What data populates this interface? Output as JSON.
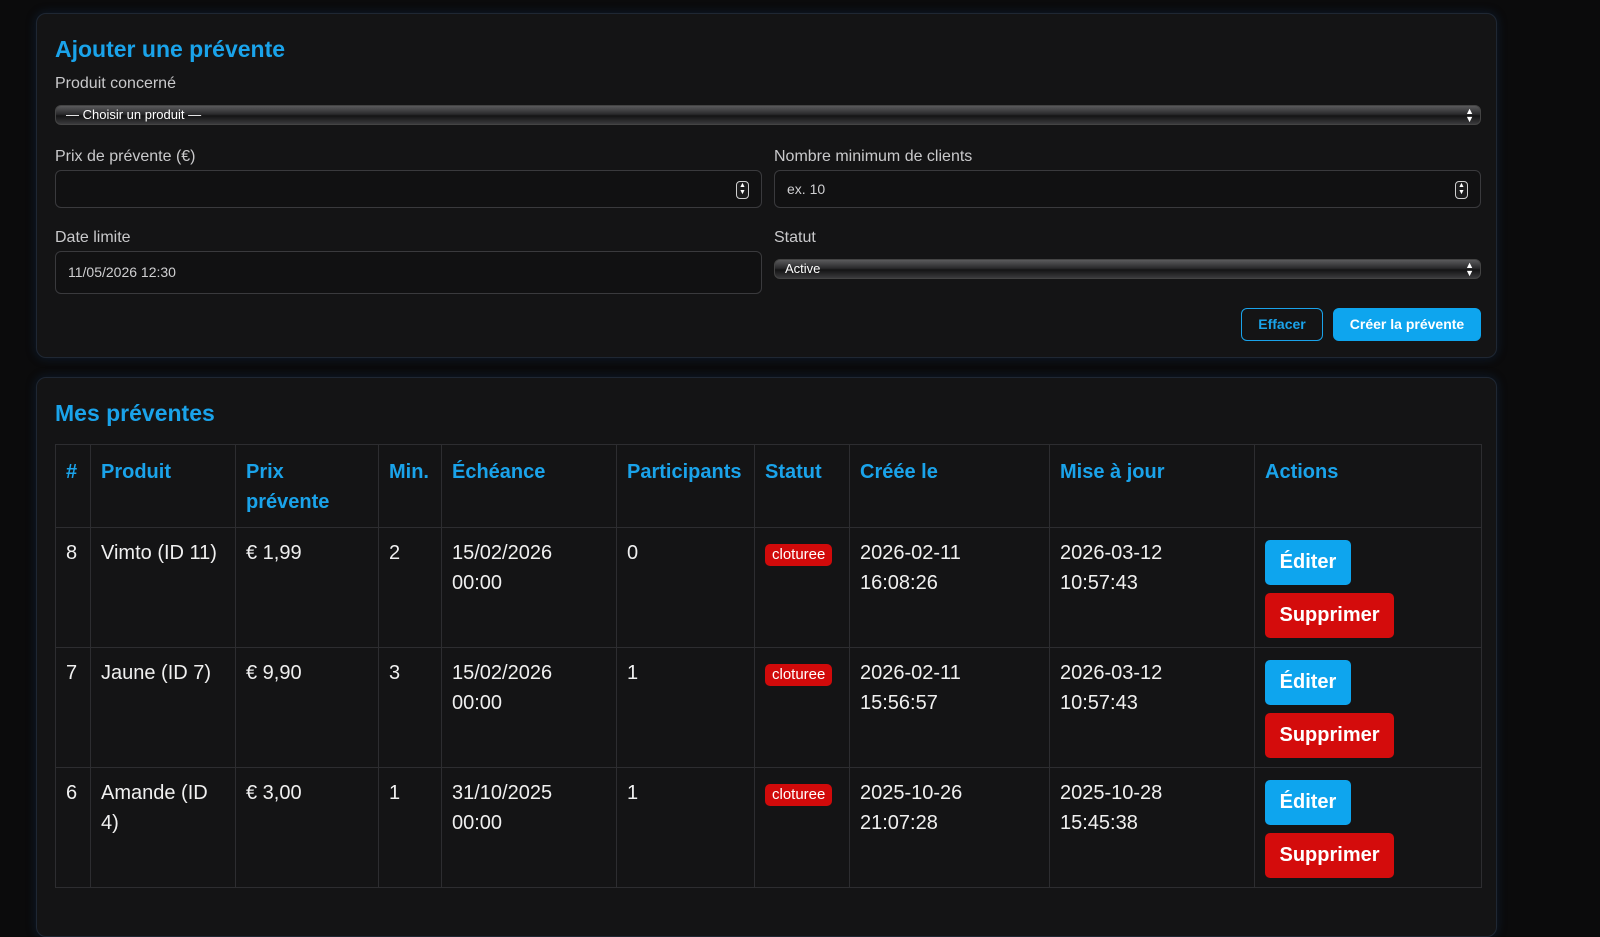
{
  "form": {
    "title": "Ajouter une prévente",
    "product_label": "Produit concerné",
    "product_value": "— Choisir un produit —",
    "price_label": "Prix de prévente (€)",
    "price_value": "",
    "min_label": "Nombre minimum de clients",
    "min_placeholder": "ex. 10",
    "date_label": "Date limite",
    "date_value": "11/05/2026 12:30",
    "status_label": "Statut",
    "status_value": "Active",
    "clear_label": "Effacer",
    "create_label": "Créer la prévente"
  },
  "list": {
    "title": "Mes préventes",
    "columns": [
      "#",
      "Produit",
      "Prix prévente",
      "Min.",
      "Échéance",
      "Participants",
      "Statut",
      "Créée le",
      "Mise à jour",
      "Actions"
    ],
    "edit_label": "Éditer",
    "delete_label": "Supprimer",
    "rows": [
      {
        "id": "8",
        "product": "Vimto (ID 11)",
        "price": "€ 1,99",
        "min": "2",
        "deadline": "15/02/2026 00:00",
        "participants": "0",
        "status": "cloturee",
        "created": "2026-02-11 16:08:26",
        "updated": "2026-03-12 10:57:43"
      },
      {
        "id": "7",
        "product": "Jaune (ID 7)",
        "price": "€ 9,90",
        "min": "3",
        "deadline": "15/02/2026 00:00",
        "participants": "1",
        "status": "cloturee",
        "created": "2026-02-11 15:56:57",
        "updated": "2026-03-12 10:57:43"
      },
      {
        "id": "6",
        "product": "Amande (ID 4)",
        "price": "€ 3,00",
        "min": "1",
        "deadline": "31/10/2025 00:00",
        "participants": "1",
        "status": "cloturee",
        "created": "2025-10-26 21:07:28",
        "updated": "2025-10-28 15:45:38"
      }
    ]
  },
  "colors": {
    "accent": "#1aa3ea",
    "danger": "#d40c0c",
    "background": "#0b0b0c",
    "card": "#141415"
  }
}
